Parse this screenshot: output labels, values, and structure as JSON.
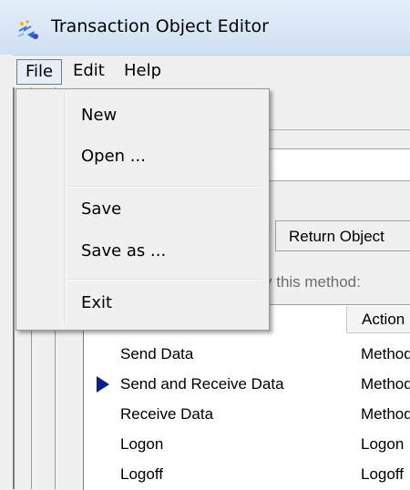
{
  "window": {
    "title": "Transaction Object Editor"
  },
  "menubar": {
    "file": "File",
    "edit": "Edit",
    "help": "Help"
  },
  "file_menu": {
    "new": "New",
    "open": "Open ...",
    "save": "Save",
    "save_as": "Save as ...",
    "exit": "Exit"
  },
  "tabs": {
    "return_object": "Return Object"
  },
  "hint": "y this method:",
  "list": {
    "header_action": "Action",
    "rows": [
      {
        "name": "Send Data",
        "action": "Method",
        "selected": false
      },
      {
        "name": "Send and Receive Data",
        "action": "Method",
        "selected": true
      },
      {
        "name": "Receive Data",
        "action": "Method",
        "selected": false
      },
      {
        "name": "Logon",
        "action": "Logon",
        "selected": false
      },
      {
        "name": "Logoff",
        "action": "Logoff",
        "selected": false
      }
    ]
  },
  "icons": {
    "app": "transaction-app-icon",
    "row_marker": "selected-row-arrow-icon"
  },
  "colors": {
    "marker": "#0a1f8f",
    "title_bar": "#d6e5f5"
  }
}
